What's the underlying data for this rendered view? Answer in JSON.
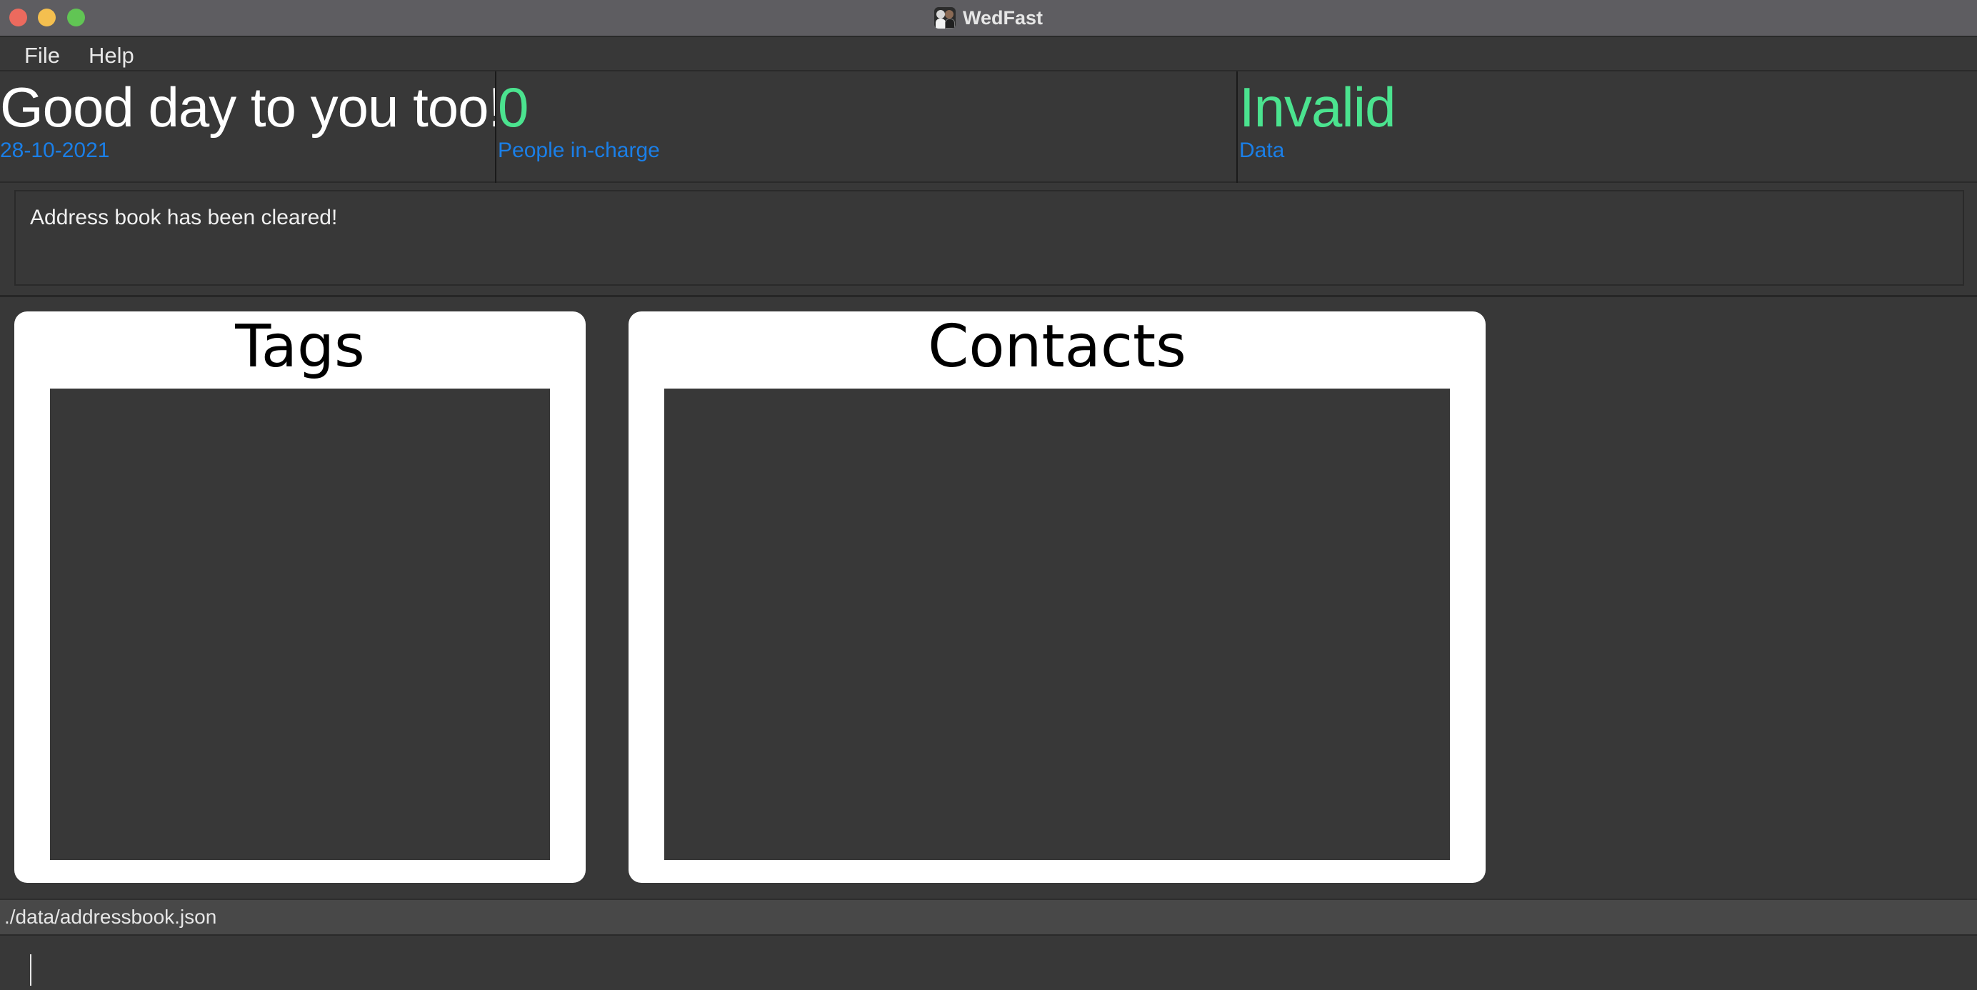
{
  "window": {
    "title": "WedFast",
    "app_icon": "wedding-couple-icon"
  },
  "menu": {
    "items": [
      "File",
      "Help"
    ]
  },
  "header": {
    "greeting": {
      "value": "Good day to you too!",
      "subtitle": "28-10-2021"
    },
    "people_in_charge": {
      "value": "0",
      "subtitle": "People in-charge"
    },
    "data_status": {
      "value": "Invalid",
      "subtitle": "Data"
    }
  },
  "result_display": {
    "message": "Address book has been cleared!"
  },
  "panels": {
    "tags": {
      "title": "Tags"
    },
    "contacts": {
      "title": "Contacts"
    }
  },
  "status_bar": {
    "file_path": "./data/addressbook.json"
  },
  "command_box": {
    "value": "",
    "placeholder": ""
  },
  "colors": {
    "background": "#383838",
    "accent_green": "#4be38f",
    "accent_blue": "#1a7fe8",
    "greeting_text": "#ffffff",
    "panel_background": "#ffffff"
  }
}
